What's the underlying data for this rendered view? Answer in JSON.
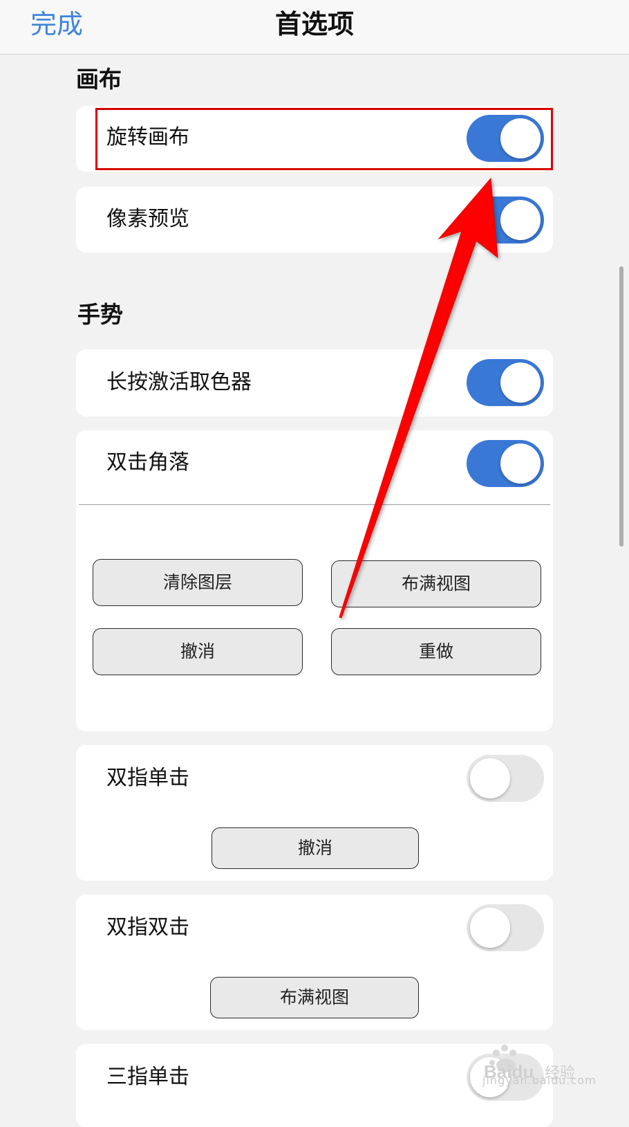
{
  "navbar": {
    "done_label": "完成",
    "title": "首选项"
  },
  "sections": {
    "canvas": {
      "header": "画布",
      "rows": [
        {
          "label": "旋转画布",
          "toggle": "on"
        },
        {
          "label": "像素预览",
          "toggle": "on"
        }
      ]
    },
    "gestures": {
      "header": "手势",
      "rows": [
        {
          "label": "长按激活取色器",
          "toggle": "on"
        },
        {
          "label": "双击角落",
          "toggle": "on",
          "buttons": [
            "清除图层",
            "布满视图",
            "撤消",
            "重做"
          ]
        },
        {
          "label": "双指单击",
          "toggle": "off",
          "button": "撤消"
        },
        {
          "label": "双指双击",
          "toggle": "off",
          "button": "布满视图"
        },
        {
          "label": "三指单击",
          "toggle": "off"
        }
      ]
    }
  },
  "annotation": {
    "highlight_color": "#d60000",
    "arrow_color": "#ff0000"
  },
  "watermark": {
    "brand": "Baidu",
    "brand_suffix": "经验",
    "url": "jingyan.baidu.com"
  },
  "colors": {
    "accent": "#3f84d8",
    "toggle_on": "#3a78d6",
    "toggle_off": "#e6e6e6",
    "background": "#f2f2f2"
  }
}
